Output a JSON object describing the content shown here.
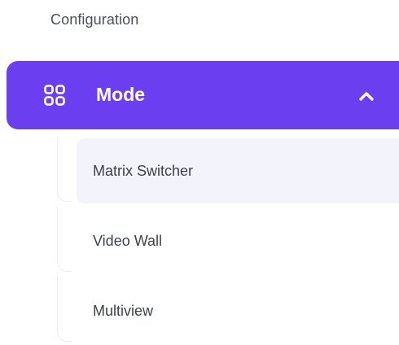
{
  "sidebar": {
    "section_title": "Configuration",
    "menu": {
      "label": "Mode",
      "icon": "grid-icon",
      "expanded_icon": "chevron-up-icon",
      "accent_color": "#6b3ff0",
      "items": [
        {
          "label": "Matrix Switcher",
          "active": true
        },
        {
          "label": "Video Wall",
          "active": false
        },
        {
          "label": "Multiview",
          "active": false
        }
      ]
    }
  }
}
